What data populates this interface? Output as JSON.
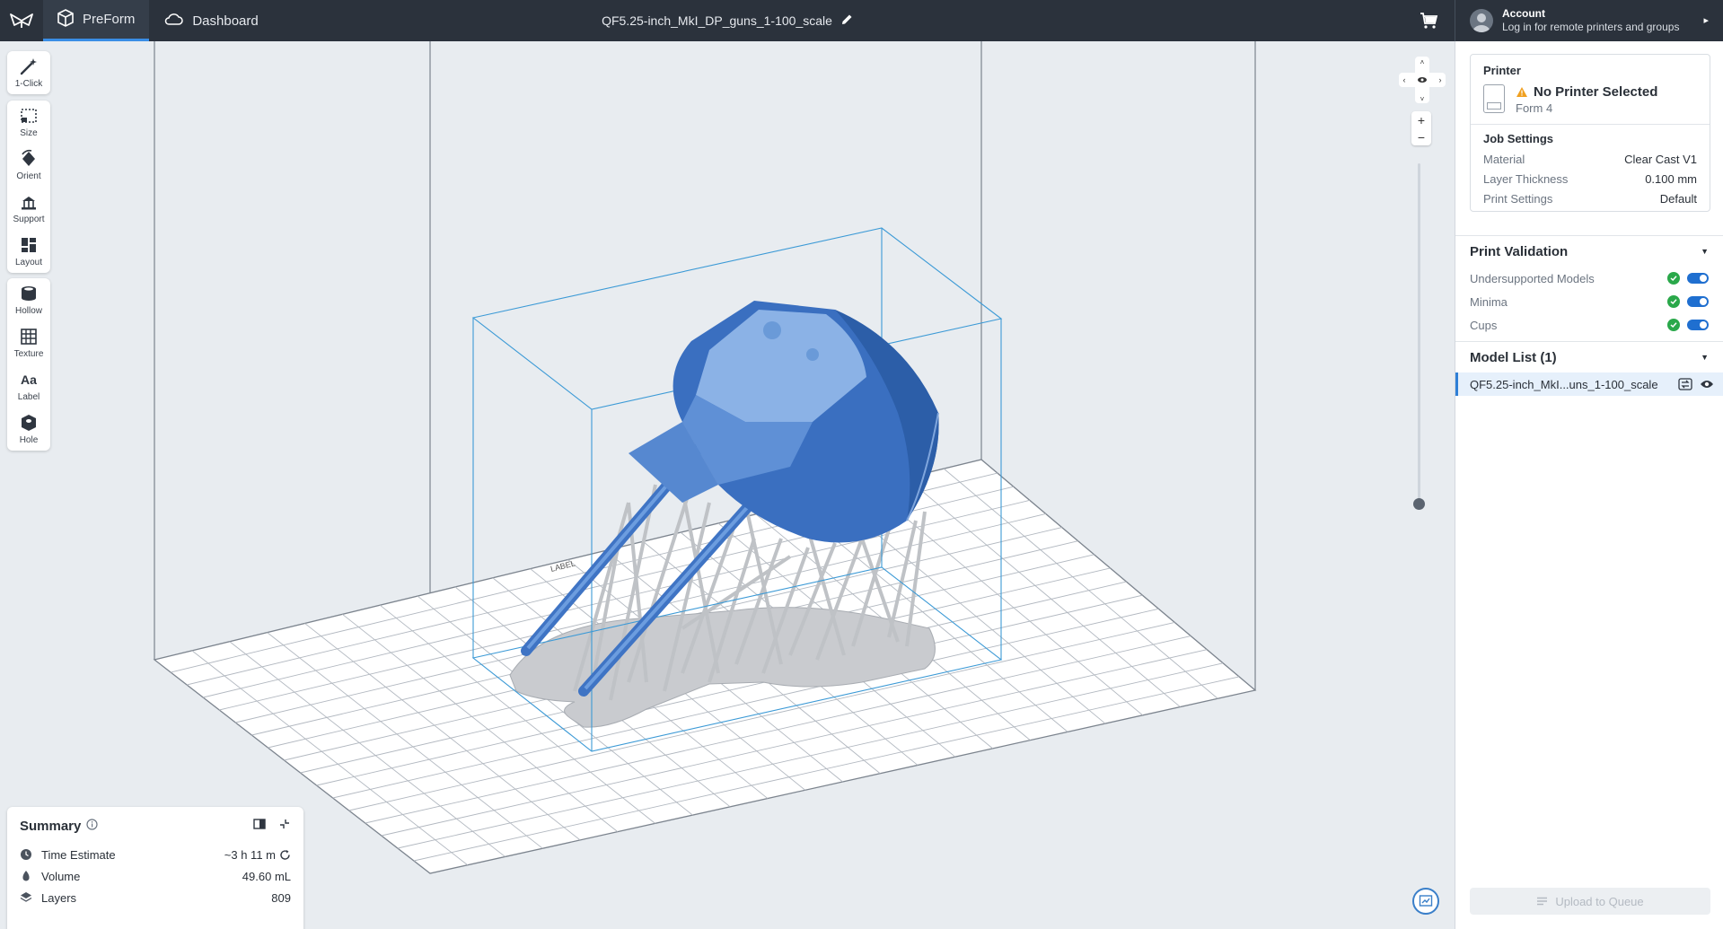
{
  "app": {
    "tabs": [
      {
        "label": "PreForm",
        "icon": "preform-cube-icon",
        "active": true
      },
      {
        "label": "Dashboard",
        "icon": "cloud-icon",
        "active": false
      }
    ],
    "file_title": "QF5.25-inch_MkI_DP_guns_1-100_scale",
    "account": {
      "title": "Account",
      "subtitle": "Log in for remote printers and groups"
    }
  },
  "toolbar": {
    "groups": [
      [
        {
          "label": "1-Click",
          "icon": "magic-wand-icon"
        }
      ],
      [
        {
          "label": "Size",
          "icon": "size-icon"
        },
        {
          "label": "Orient",
          "icon": "orient-icon"
        },
        {
          "label": "Support",
          "icon": "support-icon"
        },
        {
          "label": "Layout",
          "icon": "layout-icon"
        }
      ],
      [
        {
          "label": "Hollow",
          "icon": "hollow-icon"
        },
        {
          "label": "Texture",
          "icon": "texture-icon"
        },
        {
          "label": "Label",
          "icon": "label-icon"
        },
        {
          "label": "Hole",
          "icon": "hole-icon"
        }
      ]
    ]
  },
  "viewport": {
    "zoom_in": "+",
    "zoom_out": "−",
    "platform_label": "LABEL",
    "layer_slider_position": 0
  },
  "summary": {
    "title": "Summary",
    "rows": [
      {
        "label": "Time Estimate",
        "value": "~3 h 11 m",
        "icon": "clock-icon"
      },
      {
        "label": "Volume",
        "value": "49.60 mL",
        "icon": "volume-icon"
      },
      {
        "label": "Layers",
        "value": "809",
        "icon": "layers-icon"
      }
    ]
  },
  "printer": {
    "section_title": "Printer",
    "name": "No Printer Selected",
    "model": "Form 4"
  },
  "job_settings": {
    "title": "Job Settings",
    "rows": [
      {
        "label": "Material",
        "value": "Clear Cast V1"
      },
      {
        "label": "Layer Thickness",
        "value": "0.100 mm"
      },
      {
        "label": "Print Settings",
        "value": "Default"
      }
    ]
  },
  "print_validation": {
    "title": "Print Validation",
    "items": [
      {
        "label": "Undersupported Models",
        "ok": true,
        "enabled": true
      },
      {
        "label": "Minima",
        "ok": true,
        "enabled": true
      },
      {
        "label": "Cups",
        "ok": true,
        "enabled": true
      }
    ]
  },
  "model_list": {
    "title": "Model List (1)",
    "items": [
      {
        "name": "QF5.25-inch_MkI...uns_1-100_scale"
      }
    ]
  },
  "upload_button": "Upload to Queue",
  "colors": {
    "topbar": "#2b323c",
    "accent": "#3a8ee6",
    "model_blue": "#4a7fcc",
    "support_gray": "#c4c7cc",
    "bbox": "#3c9ad6"
  }
}
